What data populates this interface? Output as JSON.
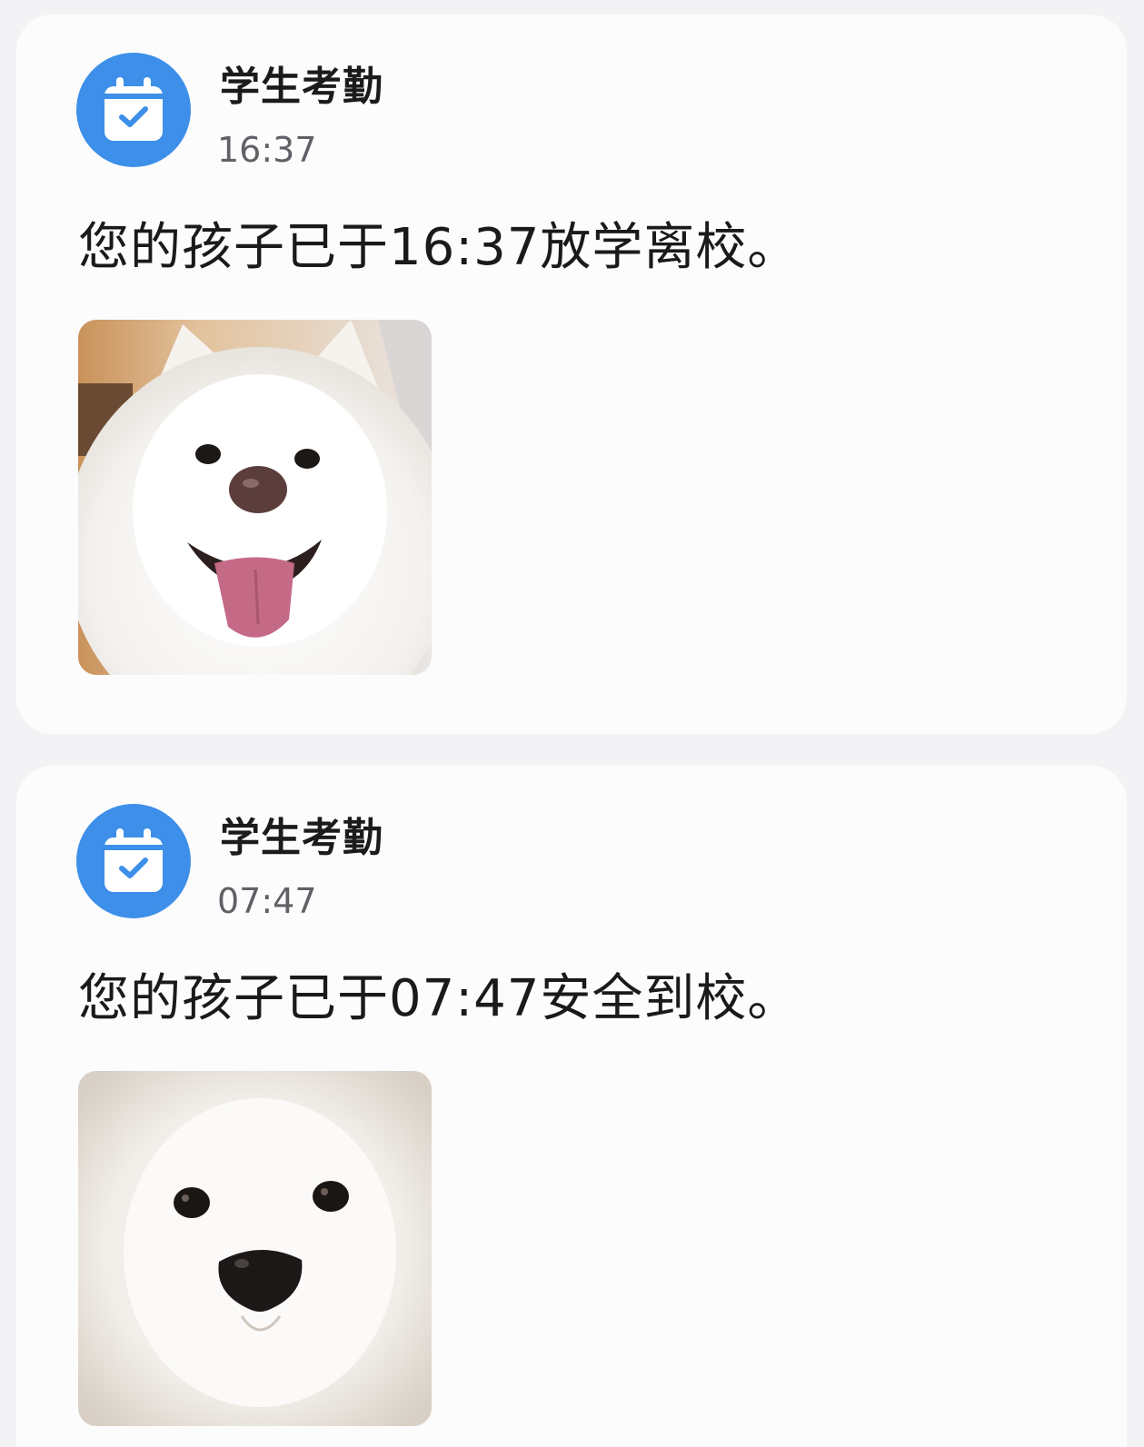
{
  "notifications": [
    {
      "icon": "calendar-check-icon",
      "app_name": "学生考勤",
      "time": "16:37",
      "message": "您的孩子已于16:37放学离校。",
      "photo": "samoyed-dog-smiling"
    },
    {
      "icon": "calendar-check-icon",
      "app_name": "学生考勤",
      "time": "07:47",
      "message": "您的孩子已于07:47安全到校。",
      "photo": "samoyed-dog-closeup"
    }
  ],
  "colors": {
    "background": "#f3f3f5",
    "card": "#fdfcfd",
    "icon_circle": "#3d8fe9",
    "icon_fg": "#ffffff"
  }
}
